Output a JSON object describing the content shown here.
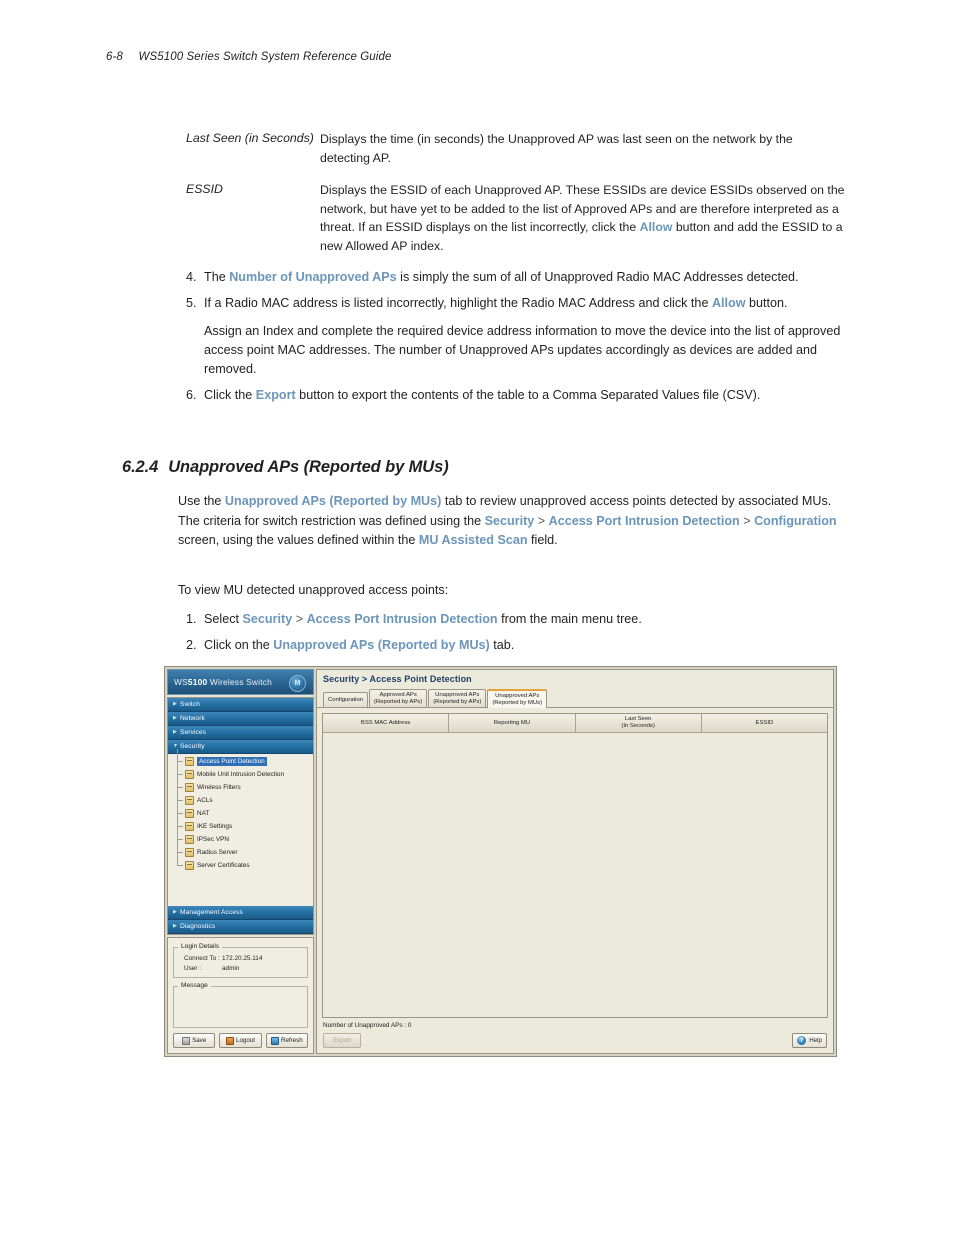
{
  "page": {
    "folio": "6-8",
    "running_head": "WS5100 Series Switch System Reference Guide"
  },
  "definitions": [
    {
      "term": "Last Seen (in Seconds)",
      "desc": "Displays the time (in seconds) the Unapproved AP was last seen on the network by the detecting AP."
    },
    {
      "term": "ESSID",
      "desc_part1": "Displays the ESSID of each Unapproved AP. These ESSIDs are device ESSIDs observed on the network, but have yet to be added to the list of Approved APs and are therefore interpreted as a threat. If an ESSID displays on the list incorrectly, click the ",
      "desc_link": "Allow",
      "desc_part2": " button and add the ESSID to a new Allowed AP index."
    }
  ],
  "steps": {
    "step4": {
      "num": "4.",
      "part1": "The ",
      "link": "Number of Unapproved APs",
      "part2": " is simply the sum of all of Unapproved Radio MAC Addresses detected."
    },
    "step5": {
      "num": "5.",
      "part1": "If a Radio MAC address is listed incorrectly, highlight the Radio MAC Address and click the ",
      "link": "Allow",
      "part2": " button.",
      "sub": "Assign an Index and complete the required device address information to move the device into the list of approved access point MAC addresses. The number of Unapproved APs updates accordingly as devices are added and removed."
    },
    "step6": {
      "num": "6.",
      "part1": "Click the ",
      "link": "Export",
      "part2": " button to export the contents of the table to a Comma Separated Values file (CSV)."
    }
  },
  "section": {
    "number": "6.2.4",
    "title": "Unapproved APs (Reported by MUs)"
  },
  "intro": {
    "p1": "Use the ",
    "link1": "Unapproved APs (Reported by MUs)",
    "p2": " tab to review unapproved access points detected by associated MUs. The criteria for switch restriction was defined using the ",
    "link2": "Security",
    "sep1": " > ",
    "link3": "Access Port Intrusion Detection",
    "sep2": " > ",
    "link4": "Configuration",
    "p3": " screen, using the values defined within the ",
    "link5": "MU Assisted Scan",
    "p4": " field."
  },
  "toview": "To view MU detected unapproved access points:",
  "steps2": {
    "step1": {
      "num": "1.",
      "part1": "Select ",
      "link1": "Security",
      "sep": " > ",
      "link2": "Access Port Intrusion Detection",
      "part2": " from the main menu tree."
    },
    "step2": {
      "num": "2.",
      "part1": "Click on the ",
      "link1": "Unapproved APs (Reported by MUs)",
      "part2": " tab."
    }
  },
  "app": {
    "brand": {
      "prefix": "WS",
      "model": "5100",
      "suffix": " Wireless Switch",
      "badge": "M"
    },
    "nav_groups_top": [
      {
        "label": "Switch",
        "expanded": false
      },
      {
        "label": "Network",
        "expanded": false
      },
      {
        "label": "Services",
        "expanded": false
      },
      {
        "label": "Security",
        "expanded": true
      }
    ],
    "nav_children": [
      {
        "label": "Access Point Detection",
        "selected": true
      },
      {
        "label": "Mobile Unit Intrusion Detection",
        "selected": false
      },
      {
        "label": "Wireless Filters",
        "selected": false
      },
      {
        "label": "ACLs",
        "selected": false
      },
      {
        "label": "NAT",
        "selected": false
      },
      {
        "label": "IKE Settings",
        "selected": false
      },
      {
        "label": "IPSec VPN",
        "selected": false
      },
      {
        "label": "Radius Server",
        "selected": false
      },
      {
        "label": "Server Certificates",
        "selected": false
      }
    ],
    "nav_groups_bottom": [
      {
        "label": "Management Access"
      },
      {
        "label": "Diagnostics"
      }
    ],
    "login": {
      "legend": "Login Details",
      "connect_label": "Connect To :",
      "connect_value": "172.20.25.114",
      "user_label": "User :",
      "user_value": "admin",
      "message_legend": "Message",
      "message_value": "",
      "save": "Save",
      "logout": "Logout",
      "refresh": "Refresh"
    },
    "breadcrumb": "Security > Access Point Detection",
    "tabs": [
      {
        "line1": "Configuration",
        "line2": "",
        "active": false
      },
      {
        "line1": "Approved APs",
        "line2": "(Reported by APs)",
        "active": false
      },
      {
        "line1": "Unapproved APs",
        "line2": "(Reported by APs)",
        "active": false
      },
      {
        "line1": "Unapproved APs",
        "line2": "(Reported by MUs)",
        "active": true
      }
    ],
    "table": {
      "columns": [
        {
          "line1": "BSS MAC Address",
          "line2": ""
        },
        {
          "line1": "Reporting MU",
          "line2": ""
        },
        {
          "line1": "Last Seen",
          "line2": "(In Seconds)"
        },
        {
          "line1": "ESSID",
          "line2": ""
        }
      ],
      "rows": []
    },
    "footer": {
      "count_text": "Number of Unapproved APs : 0",
      "export": "Export",
      "help": "Help",
      "help_glyph": "?"
    }
  },
  "colors": {
    "accent_link": "#6b95b9",
    "nav_blue": "#2470a4",
    "brand_dark": "#1d4f78",
    "tab_active_border": "#e5a23c",
    "selection_blue": "#2f6fb5"
  }
}
